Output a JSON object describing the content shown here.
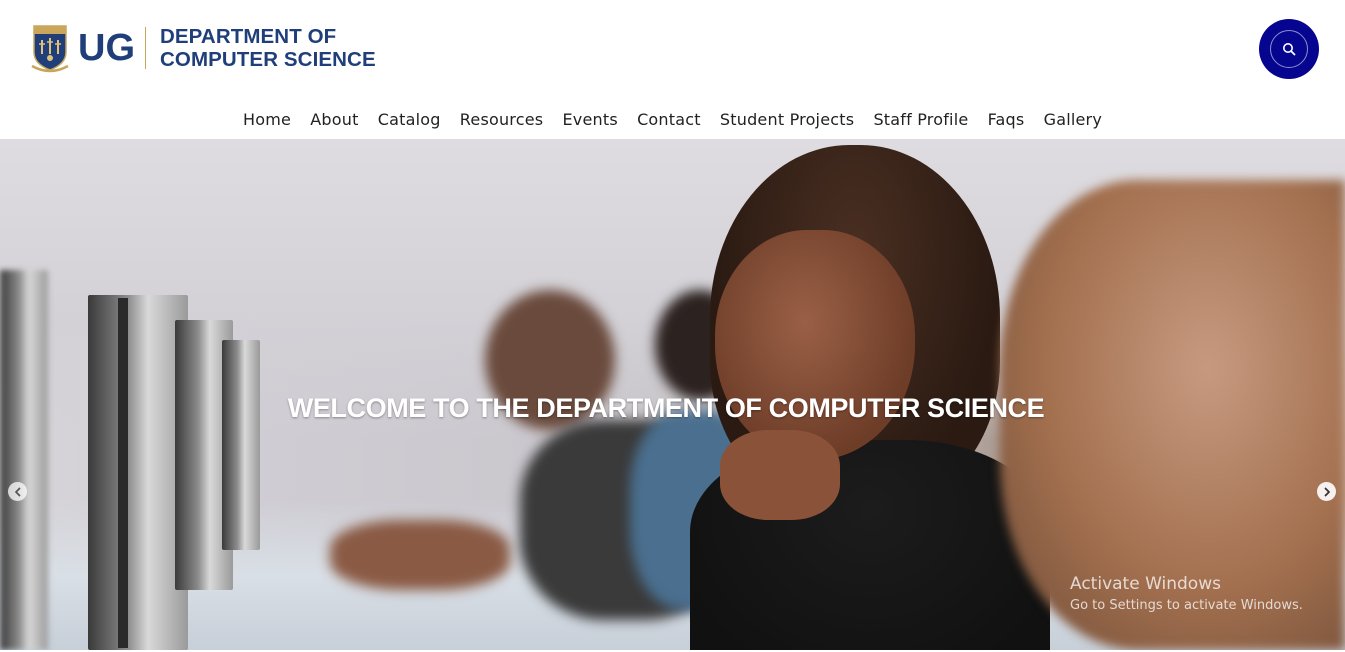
{
  "header": {
    "logo_short": "UG",
    "dept_line1": "DEPARTMENT OF",
    "dept_line2": "COMPUTER SCIENCE",
    "search_icon": "search-icon"
  },
  "nav": {
    "items": [
      "Home",
      "About",
      "Catalog",
      "Resources",
      "Events",
      "Contact",
      "Student Projects",
      "Staff Profile",
      "Faqs",
      "Gallery"
    ]
  },
  "hero": {
    "title": "WELCOME TO THE DEPARTMENT OF COMPUTER SCIENCE",
    "prev_icon": "chevron-left-icon",
    "next_icon": "chevron-right-icon"
  },
  "watermark": {
    "line1": "Activate Windows",
    "line2": "Go to Settings to activate Windows."
  },
  "colors": {
    "brand_blue": "#1f3e7a",
    "search_button": "#050590",
    "gold": "#c9a65a"
  }
}
